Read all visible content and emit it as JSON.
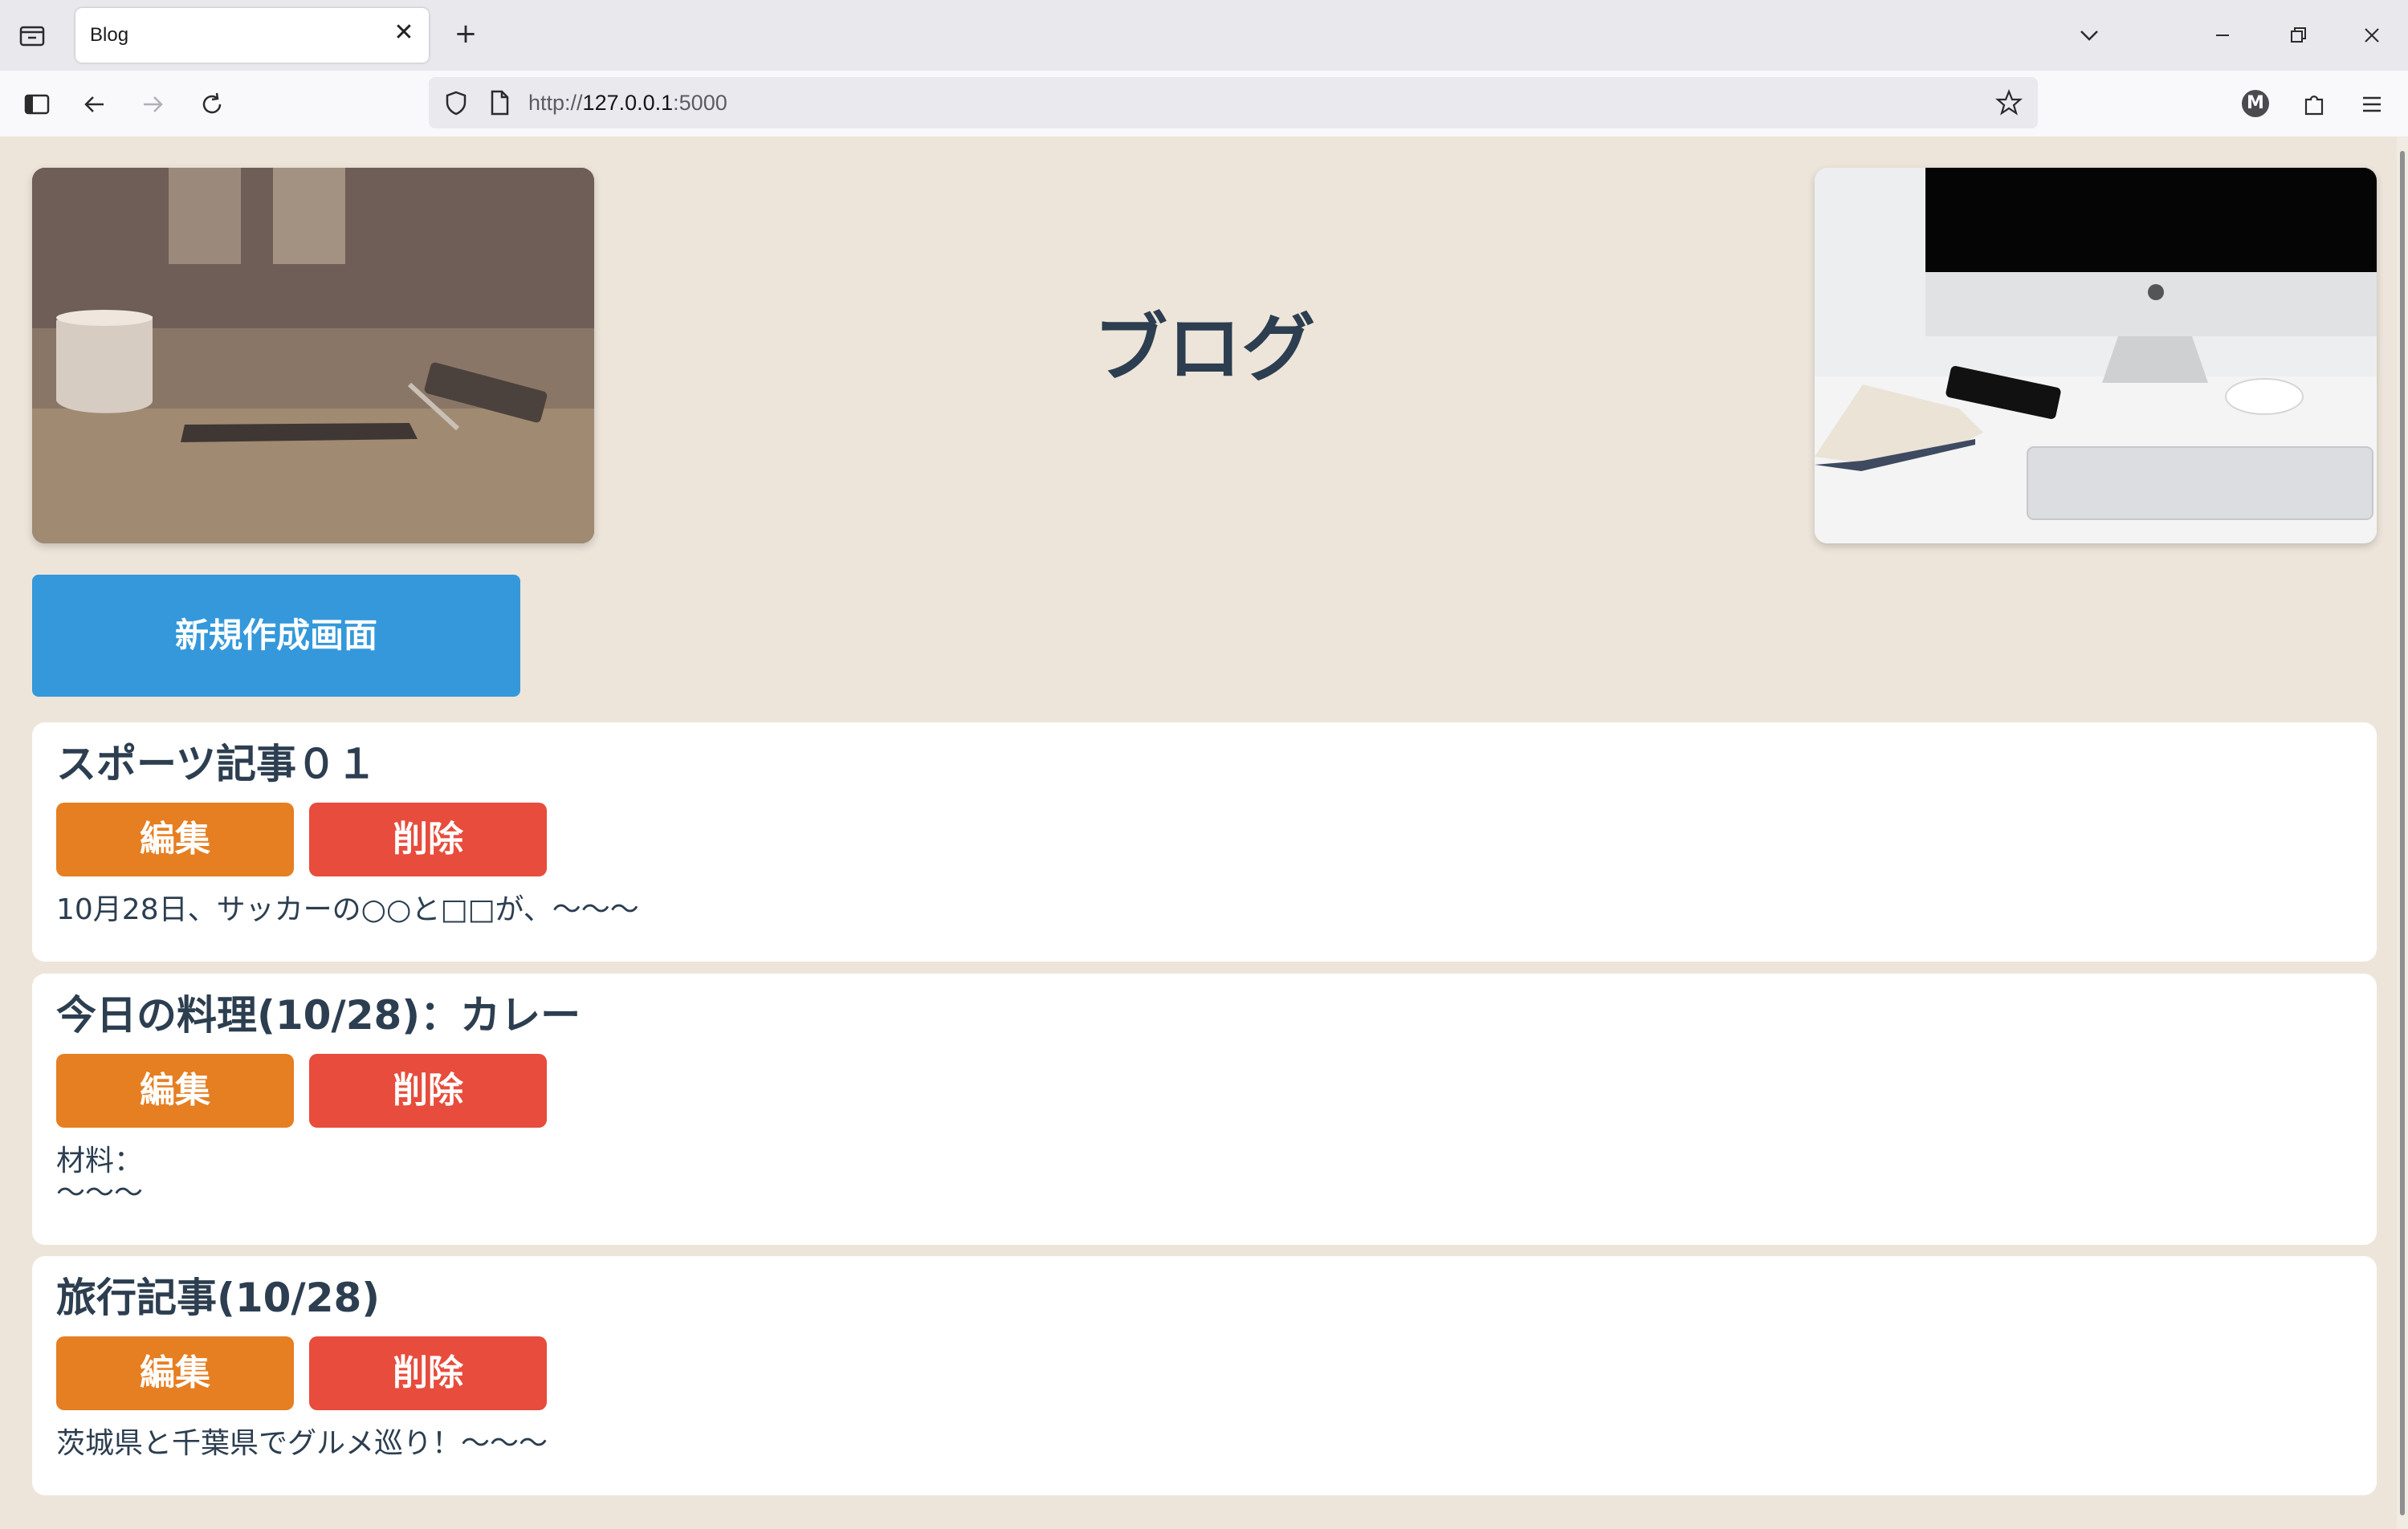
{
  "browser": {
    "tab_title": "Blog",
    "tab_close": "✕",
    "new_tab": "+",
    "url_prefix": "http://",
    "url_host": "127.0.0.1",
    "url_port": ":5000",
    "profile_initial": "M"
  },
  "header": {
    "title": "ブログ",
    "new_button": "新規作成画面"
  },
  "posts": [
    {
      "title": "スポーツ記事０１",
      "edit": "編集",
      "delete": "削除",
      "body": "10月28日、サッカーの○○と□□が、〜〜〜"
    },
    {
      "title": "今日の料理(10/28)：カレー",
      "edit": "編集",
      "delete": "削除",
      "body": "材料：\n〜〜〜"
    },
    {
      "title": "旅行記事(10/28)",
      "edit": "編集",
      "delete": "削除",
      "body": "茨城県と千葉県でグルメ巡り！〜〜〜"
    }
  ],
  "colors": {
    "page_bg": "#ede5da",
    "title": "#2c3e50",
    "new_button": "#3498db",
    "edit_button": "#e67e22",
    "delete_button": "#e74c3c"
  }
}
